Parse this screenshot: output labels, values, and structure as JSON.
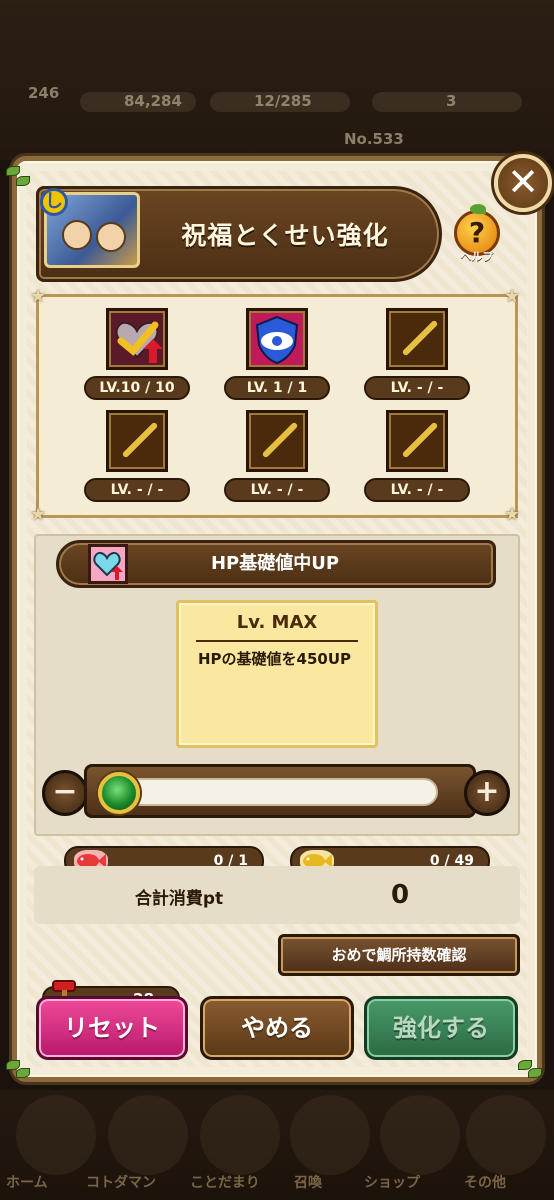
{
  "background": {
    "stats": {
      "a": "246",
      "b": "84,284",
      "c": "12/285",
      "d": "3"
    },
    "number": "No.533",
    "nav": [
      "ホーム",
      "コトダマン",
      "ことだまり",
      "召喚",
      "ショップ",
      "その他"
    ]
  },
  "modal": {
    "title": "祝福とくせい強化",
    "help_label": "ヘルプ",
    "close_glyph": "✕"
  },
  "skills": [
    {
      "level": "LV.10 / 10",
      "icon": "heart-check-icon",
      "state": "heart"
    },
    {
      "level": "LV.  1 / 1",
      "icon": "shield-eye-icon",
      "state": "shield"
    },
    {
      "level": "LV.  - / -",
      "icon": "empty-slot-icon",
      "state": "empty"
    },
    {
      "level": "LV.  - / -",
      "icon": "empty-slot-icon",
      "state": "empty"
    },
    {
      "level": "LV.  - / -",
      "icon": "empty-slot-icon",
      "state": "empty"
    },
    {
      "level": "LV.  - / -",
      "icon": "empty-slot-icon",
      "state": "empty"
    }
  ],
  "detail": {
    "title": "HP基礎値中UP",
    "level_title": "Lv. MAX",
    "description": "HPの基礎値を450UP",
    "slider_value": 0
  },
  "costs": {
    "red_tai": "0 / 1",
    "gold_tai": "0 / 49",
    "total_label": "合計消費pt",
    "total_value": "0"
  },
  "buttons": {
    "check": "おめで鯛所持数確認",
    "reset_count": "28",
    "reset": "リセット",
    "cancel": "やめる",
    "enhance": "強化する",
    "minus": "−",
    "plus": "+"
  },
  "colors": {
    "frame": "#8c6a3c",
    "reset": "#e0307e",
    "enhance": "#2f7a4c"
  }
}
